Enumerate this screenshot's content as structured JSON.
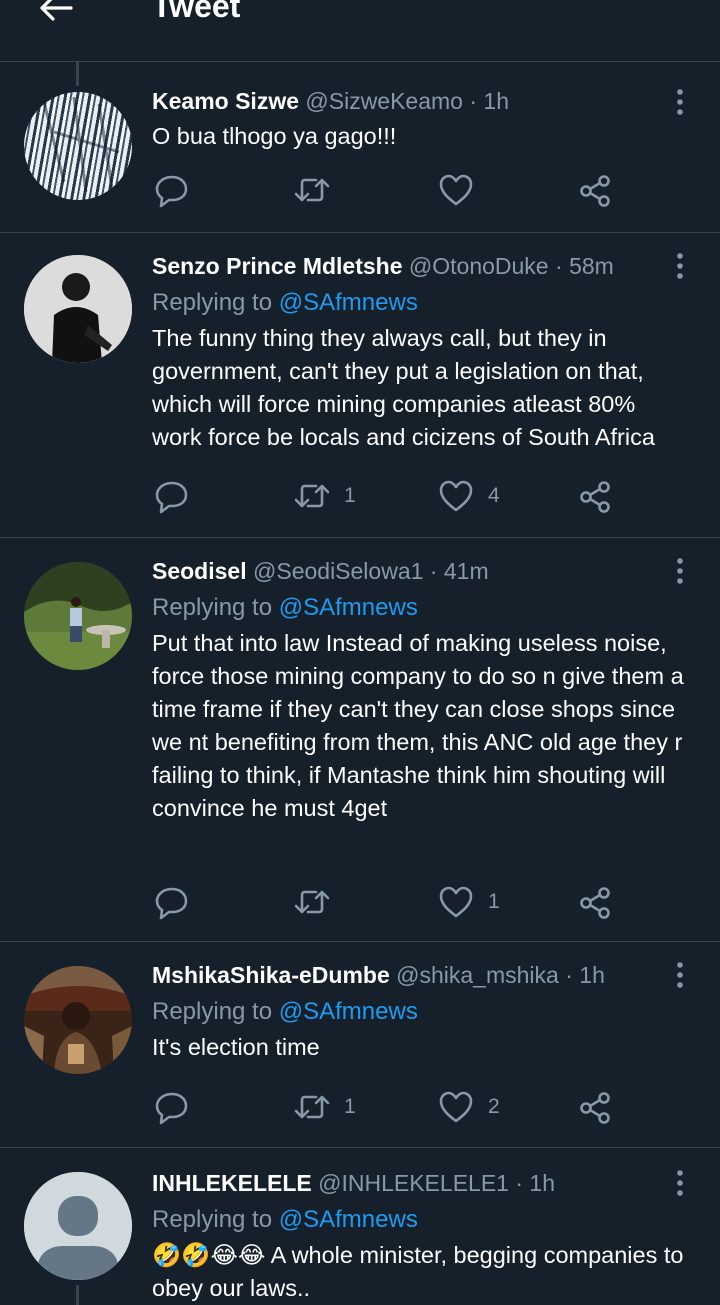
{
  "header": {
    "title": "Tweet"
  },
  "tweets": [
    {
      "name": "Keamo Sizwe",
      "handle": "@SizweKeamo",
      "dot": "·",
      "time": "1h",
      "replying_prefix": "",
      "replying_to": "",
      "text": "O bua tlhogo ya gago!!!",
      "retweets": "",
      "likes": ""
    },
    {
      "name": "Senzo Prince Mdletshe",
      "handle": "@OtonoDuke",
      "dot": "·",
      "time": "58m",
      "replying_prefix": "Replying to ",
      "replying_to": "@SAfmnews",
      "text": "The funny thing they always call, but they in government, can't they put a legislation on that, which will force mining companies atleast 80% work force be locals and cicizens of South Africa",
      "retweets": "1",
      "likes": "4"
    },
    {
      "name": "Seodisel",
      "handle": "@SeodiSelowa1",
      "dot": "·",
      "time": "41m",
      "replying_prefix": "Replying to ",
      "replying_to": "@SAfmnews",
      "text": "Put that into law Instead of making useless noise, force those mining company to do so n give them a time frame if they can't they can close shops since we nt benefiting from them, this ANC old age they r failing to think, if Mantashe think him shouting will convince he must 4get",
      "retweets": "",
      "likes": "1"
    },
    {
      "name": "MshikaShika-eDumbe",
      "handle": "@shika_mshika",
      "dot": "·",
      "time": "1h",
      "replying_prefix": "Replying to ",
      "replying_to": "@SAfmnews",
      "text": "It's election time",
      "retweets": "1",
      "likes": "2"
    },
    {
      "name": "INHLEKELELE",
      "handle": "@INHLEKELELE1",
      "dot": "·",
      "time": "1h",
      "replying_prefix": "Replying to ",
      "replying_to": "@SAfmnews",
      "text": "🤣🤣😂😂 A whole minister, begging companies to obey our laws..",
      "retweets": "",
      "likes": ""
    }
  ],
  "colors": {
    "background": "#15202b",
    "accent": "#1d9bf0",
    "muted": "#8899a6",
    "divider": "#38444d"
  },
  "icons": [
    "back-arrow-icon",
    "reply-icon",
    "retweet-icon",
    "like-icon",
    "share-icon",
    "more-icon"
  ]
}
